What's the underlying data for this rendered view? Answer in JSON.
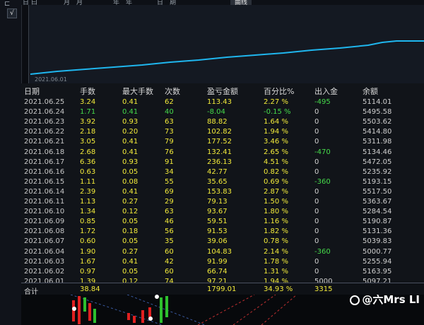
{
  "toolbar": {
    "tabs": [
      "日",
      "曰",
      "月",
      "月",
      "年",
      "年",
      "日",
      "期",
      "曲线"
    ],
    "active_tab": "曲线",
    "toggle_checked": "√"
  },
  "equity_chart": {
    "start_date_label": "2021.06.01",
    "line_color": "#1fb6ee"
  },
  "table": {
    "headers": [
      "日期",
      "手数",
      "最大手数",
      "次数",
      "盈亏金额",
      "百分比%",
      "出入金",
      "余额"
    ],
    "rows": [
      {
        "date": "2021.06.25",
        "hands": "3.24",
        "max": "0.41",
        "count": "62",
        "pnl": "113.43",
        "pct": "2.27 %",
        "flow": "-495",
        "bal": "5114.01"
      },
      {
        "date": "2021.06.24",
        "hands": "1.71",
        "max": "0.41",
        "count": "40",
        "pnl": "-8.04",
        "pct": "-0.15 %",
        "flow": "0",
        "bal": "5495.58"
      },
      {
        "date": "2021.06.23",
        "hands": "3.92",
        "max": "0.93",
        "count": "63",
        "pnl": "88.82",
        "pct": "1.64 %",
        "flow": "0",
        "bal": "5503.62"
      },
      {
        "date": "2021.06.22",
        "hands": "2.18",
        "max": "0.20",
        "count": "73",
        "pnl": "102.82",
        "pct": "1.94 %",
        "flow": "0",
        "bal": "5414.80"
      },
      {
        "date": "2021.06.21",
        "hands": "3.05",
        "max": "0.41",
        "count": "79",
        "pnl": "177.52",
        "pct": "3.46 %",
        "flow": "0",
        "bal": "5311.98"
      },
      {
        "date": "2021.06.18",
        "hands": "2.68",
        "max": "0.41",
        "count": "76",
        "pnl": "132.41",
        "pct": "2.65 %",
        "flow": "-470",
        "bal": "5134.46"
      },
      {
        "date": "2021.06.17",
        "hands": "6.36",
        "max": "0.93",
        "count": "91",
        "pnl": "236.13",
        "pct": "4.51 %",
        "flow": "0",
        "bal": "5472.05"
      },
      {
        "date": "2021.06.16",
        "hands": "0.63",
        "max": "0.05",
        "count": "34",
        "pnl": "42.77",
        "pct": "0.82 %",
        "flow": "0",
        "bal": "5235.92"
      },
      {
        "date": "2021.06.15",
        "hands": "1.11",
        "max": "0.08",
        "count": "55",
        "pnl": "35.65",
        "pct": "0.69 %",
        "flow": "-360",
        "bal": "5193.15"
      },
      {
        "date": "2021.06.14",
        "hands": "2.39",
        "max": "0.41",
        "count": "69",
        "pnl": "153.83",
        "pct": "2.87 %",
        "flow": "0",
        "bal": "5517.50"
      },
      {
        "date": "2021.06.11",
        "hands": "1.13",
        "max": "0.27",
        "count": "29",
        "pnl": "79.13",
        "pct": "1.50 %",
        "flow": "0",
        "bal": "5363.67"
      },
      {
        "date": "2021.06.10",
        "hands": "1.34",
        "max": "0.12",
        "count": "63",
        "pnl": "93.67",
        "pct": "1.80 %",
        "flow": "0",
        "bal": "5284.54"
      },
      {
        "date": "2021.06.09",
        "hands": "0.85",
        "max": "0.05",
        "count": "46",
        "pnl": "59.51",
        "pct": "1.16 %",
        "flow": "0",
        "bal": "5190.87"
      },
      {
        "date": "2021.06.08",
        "hands": "1.72",
        "max": "0.18",
        "count": "56",
        "pnl": "91.53",
        "pct": "1.82 %",
        "flow": "0",
        "bal": "5131.36"
      },
      {
        "date": "2021.06.07",
        "hands": "0.60",
        "max": "0.05",
        "count": "35",
        "pnl": "39.06",
        "pct": "0.78 %",
        "flow": "0",
        "bal": "5039.83"
      },
      {
        "date": "2021.06.04",
        "hands": "1.90",
        "max": "0.27",
        "count": "60",
        "pnl": "104.83",
        "pct": "2.14 %",
        "flow": "-360",
        "bal": "5000.77"
      },
      {
        "date": "2021.06.03",
        "hands": "1.67",
        "max": "0.41",
        "count": "42",
        "pnl": "91.99",
        "pct": "1.78 %",
        "flow": "0",
        "bal": "5255.94"
      },
      {
        "date": "2021.06.02",
        "hands": "0.97",
        "max": "0.05",
        "count": "60",
        "pnl": "66.74",
        "pct": "1.31 %",
        "flow": "0",
        "bal": "5163.95"
      },
      {
        "date": "2021.06.01",
        "hands": "1.39",
        "max": "0.12",
        "count": "74",
        "pnl": "97.21",
        "pct": "1.94 %",
        "flow": "5000",
        "bal": "5097.21"
      }
    ],
    "footer": {
      "label": "合计",
      "hands": "38.84",
      "pnl": "1799.01",
      "pct": "34.93 %",
      "flow": "3315"
    }
  },
  "watermark": "@六Mrs LI",
  "colors": {
    "positive": "#f2ea3a",
    "negative": "#45d94a",
    "neutral": "#d0d0d0",
    "background": "#111419"
  }
}
